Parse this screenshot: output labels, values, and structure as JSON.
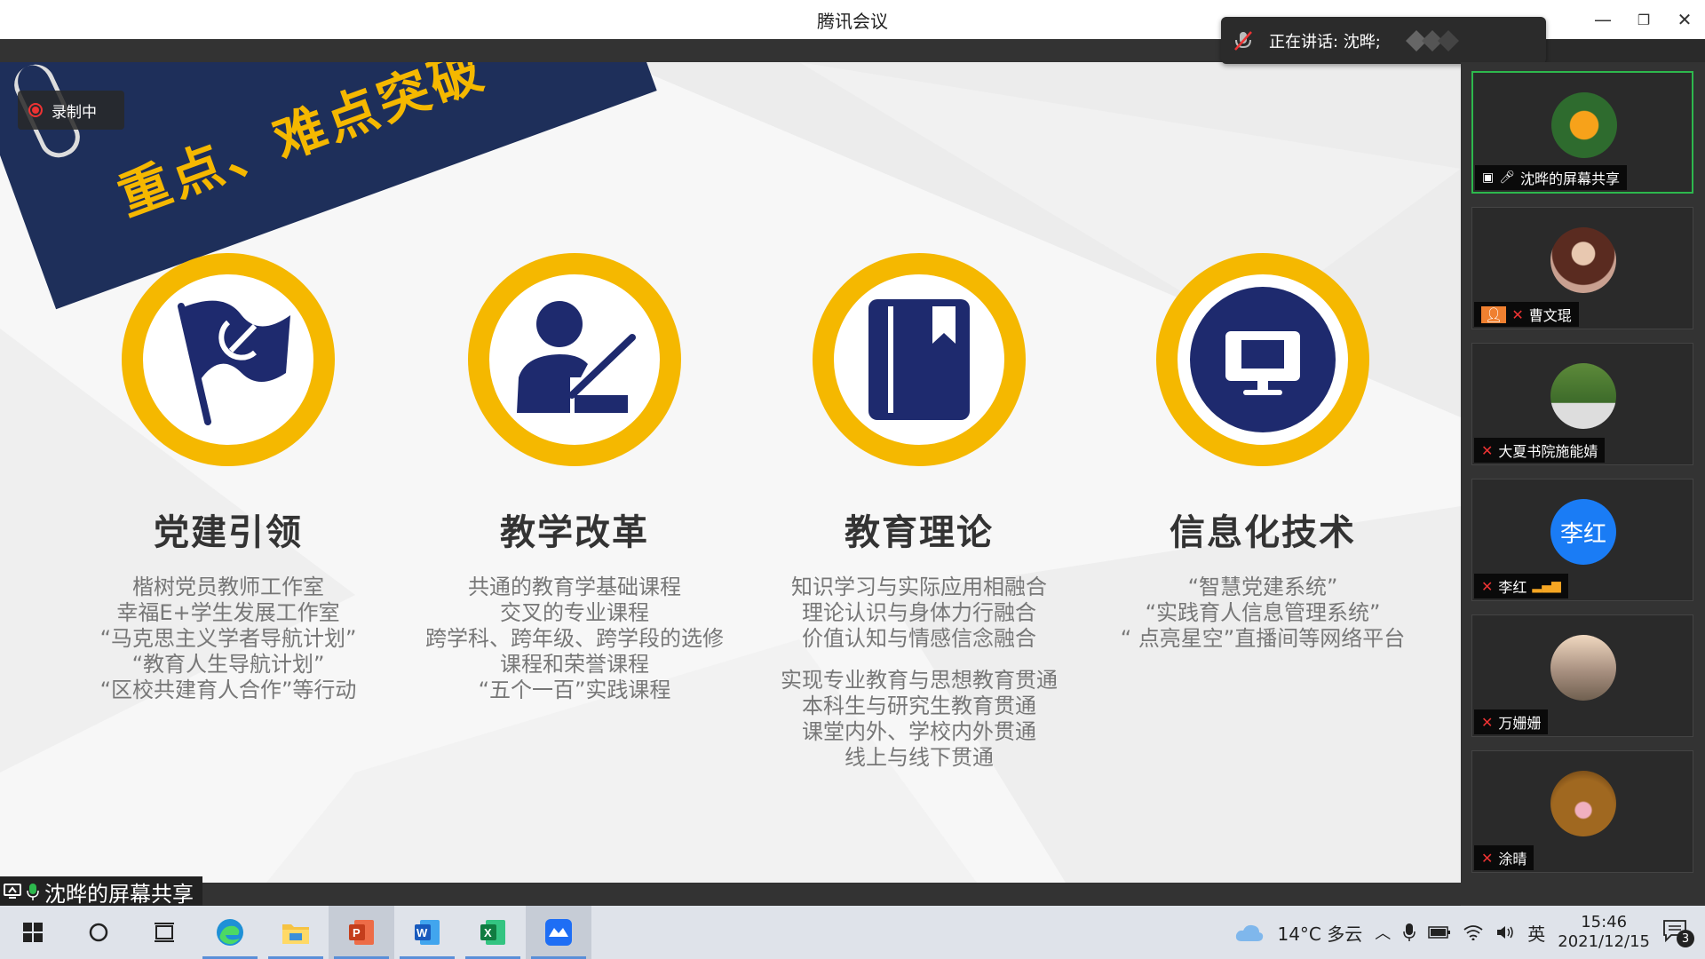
{
  "window": {
    "title": "腾讯会议",
    "minimize": "—",
    "restore": "❐",
    "close": "✕"
  },
  "speaking": {
    "label": "正在讲话: 沈晔;"
  },
  "recording": {
    "label": "录制中"
  },
  "slide": {
    "banner": "重点、难点突破",
    "columns": [
      {
        "title": "党建引领",
        "lines": [
          "楷树党员教师工作室",
          "幸福E+学生发展工作室",
          "“马克思主义学者导航计划”",
          "“教育人生导航计划”",
          "“区校共建育人合作”等行动"
        ]
      },
      {
        "title": "教学改革",
        "lines": [
          "共通的教育学基础课程",
          "交叉的专业课程",
          "跨学科、跨年级、跨学段的选修",
          "课程和荣誉课程",
          "“五个一百”实践课程"
        ]
      },
      {
        "title": "教育理论",
        "lines": [
          "知识学习与实际应用相融合",
          "理论认识与身体力行融合",
          "价值认知与情感信念融合"
        ],
        "lines2": [
          "实现专业教育与思想教育贯通",
          "本科生与研究生教育贯通",
          "课堂内外、学校内外贯通",
          "线上与线下贯通"
        ]
      },
      {
        "title": "信息化技术",
        "lines": [
          "“智慧党建系统”",
          "“实践育人信息管理系统”",
          "“ 点亮星空”直播间等网络平台"
        ]
      }
    ]
  },
  "screen_share": {
    "label": "沈晔的屏幕共享"
  },
  "participants": [
    {
      "name": "沈晔的屏幕共享",
      "avatar": "orange-flower",
      "active": true
    },
    {
      "name": "曹文琨",
      "avatar": "woman-photo"
    },
    {
      "name": "大夏书院施能婧",
      "avatar": "wedding-photo"
    },
    {
      "name": "李红",
      "avatar": "text",
      "avatar_text": "李红"
    },
    {
      "name": "万姗姗",
      "avatar": "beach-photo"
    },
    {
      "name": "涂晴",
      "avatar": "autumn-photo"
    }
  ],
  "taskbar": {
    "weather": "14°C 多云",
    "ime": "英",
    "time": "15:46",
    "date": "2021/12/15",
    "notifications": "3"
  }
}
